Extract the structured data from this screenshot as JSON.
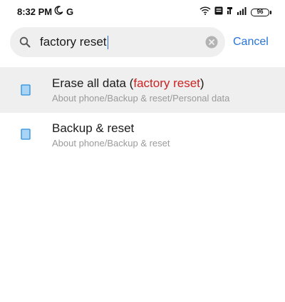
{
  "status_bar": {
    "time": "8:32 PM",
    "left_icons": [
      "moon-icon",
      "g-icon"
    ],
    "g_label": "G",
    "right_icons": [
      "wifi-icon",
      "volte-icon",
      "network-4g-icon",
      "signal-icon",
      "battery-icon"
    ],
    "battery_level": "96"
  },
  "search": {
    "query": "factory reset",
    "icon": "search-icon",
    "clear_icon": "clear-icon",
    "cancel_label": "Cancel"
  },
  "results": [
    {
      "title_before": "Erase all data (",
      "title_highlight": "factory reset",
      "title_after": ")",
      "path": "About phone/Backup & reset/Personal data",
      "icon": "phone-icon",
      "highlighted": true
    },
    {
      "title_before": "",
      "title_highlight": "",
      "title_after": "Backup & reset",
      "path": "About phone/Backup & reset",
      "icon": "phone-icon",
      "highlighted": false
    }
  ],
  "colors": {
    "accent": "#2a74d5",
    "highlight_text": "#cc2222",
    "search_bg": "#efefef",
    "secondary_text": "#9a9a9a",
    "icon_fill": "#a9d4f5",
    "icon_stroke": "#2b8fdb"
  }
}
